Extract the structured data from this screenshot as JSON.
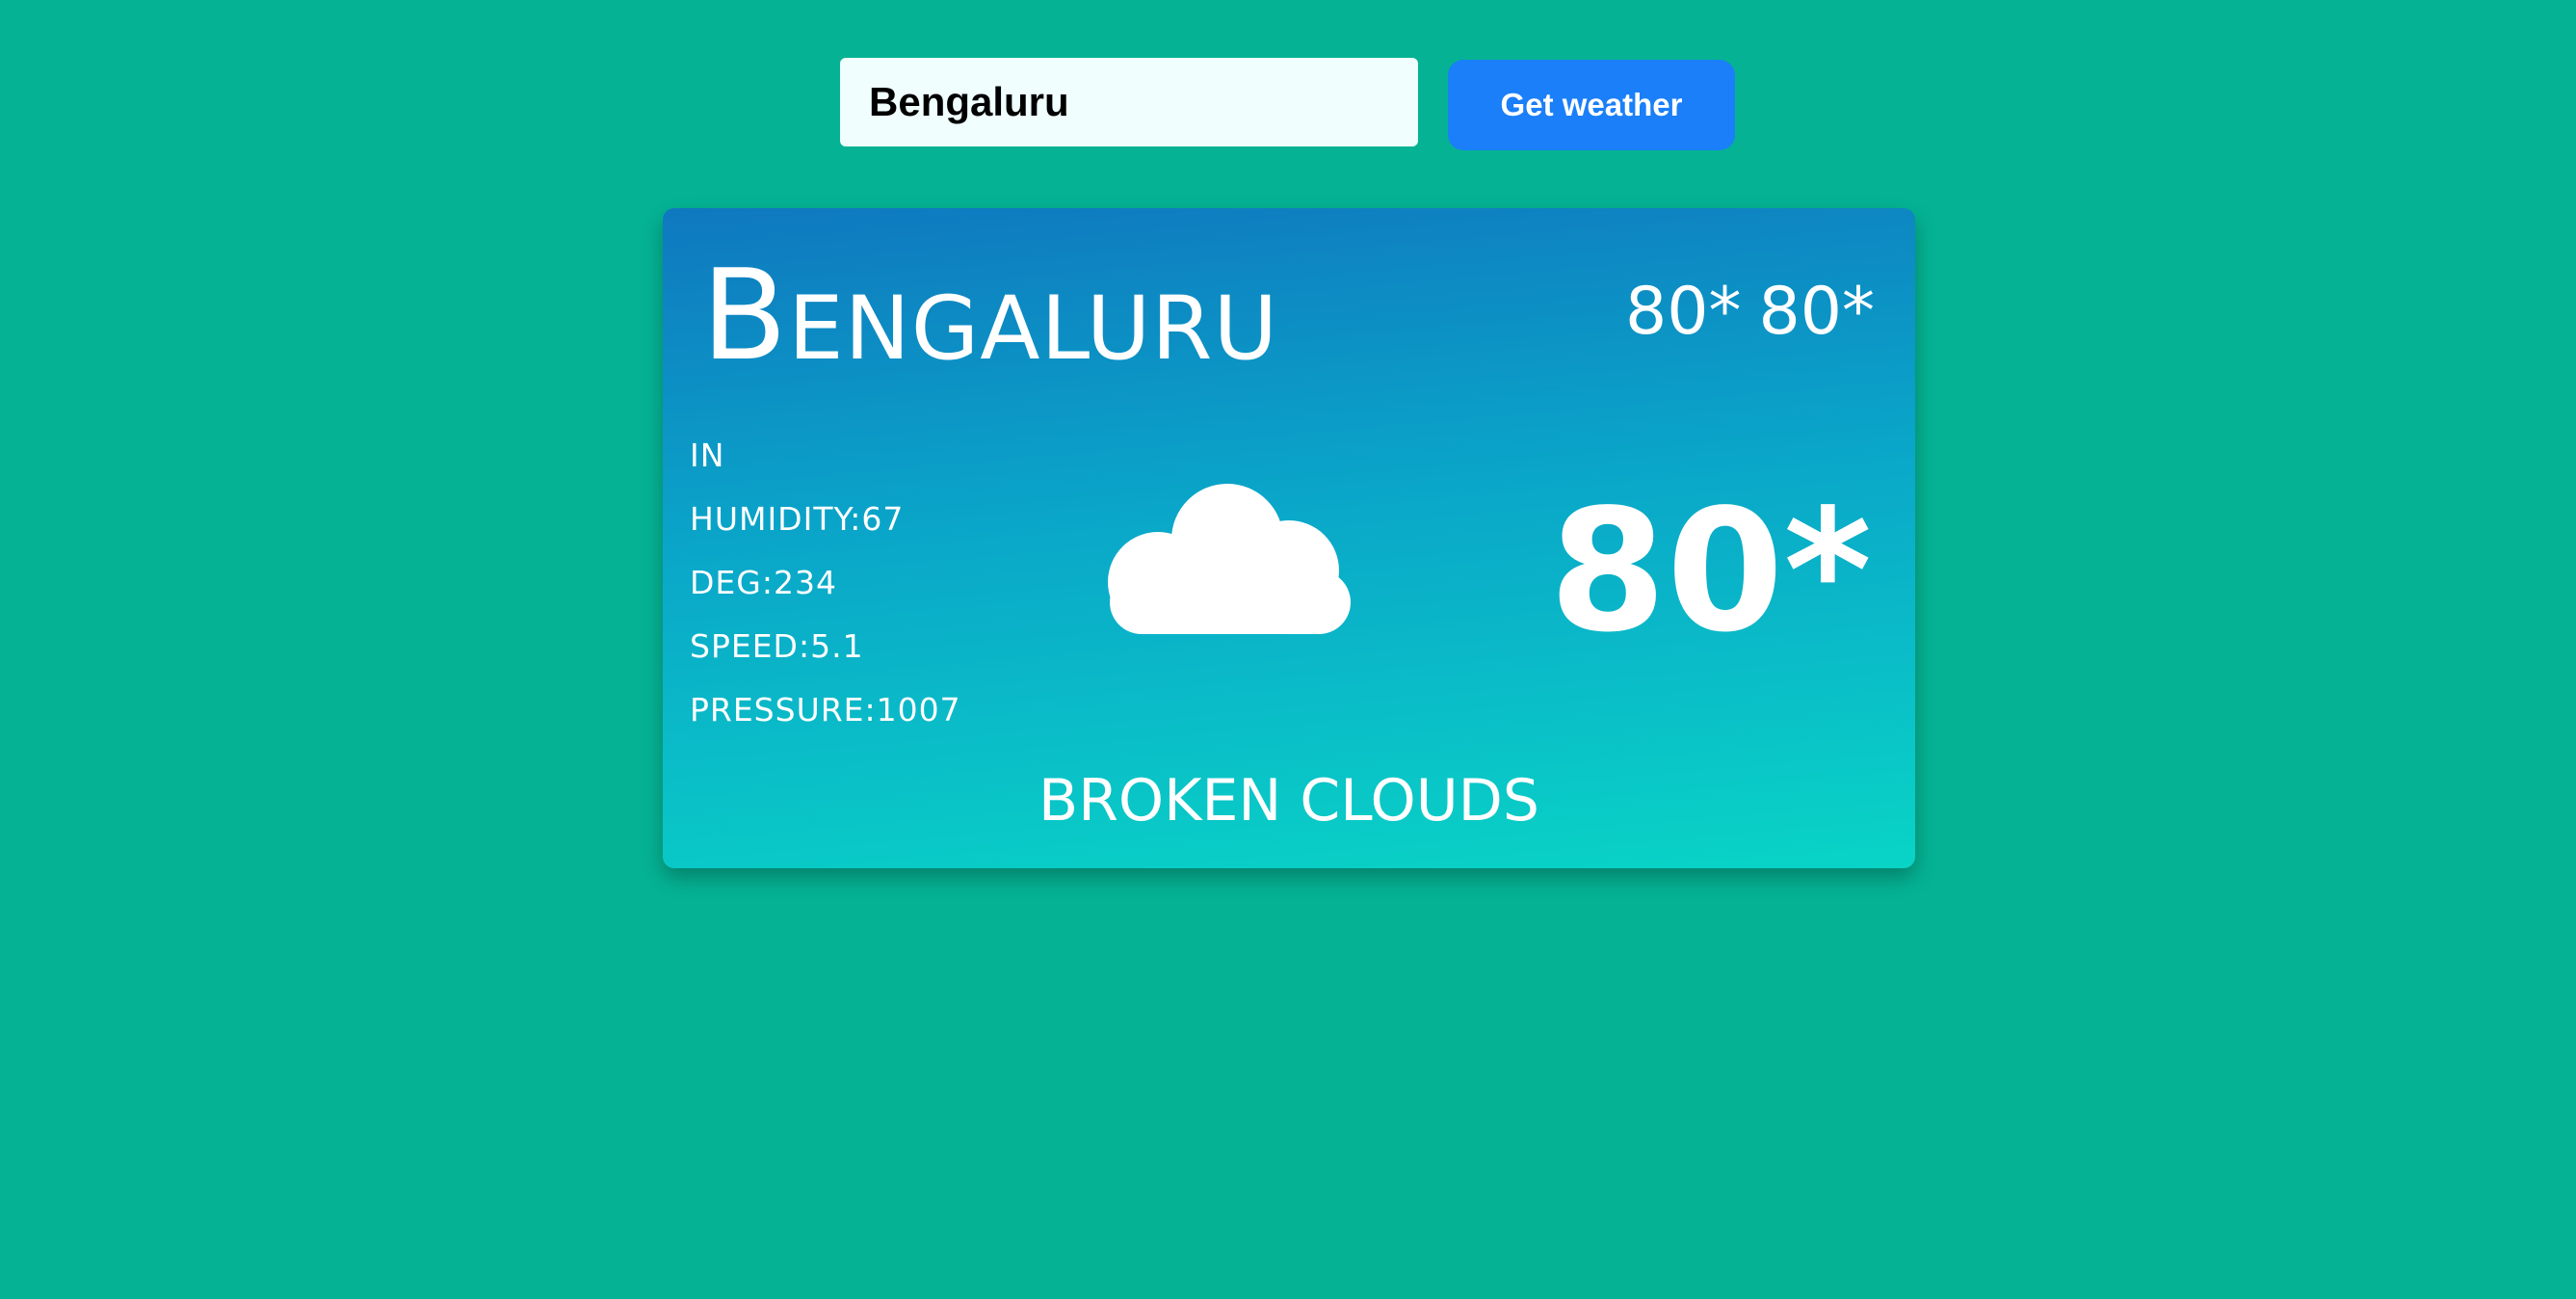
{
  "search": {
    "value": "Bengaluru",
    "button_label": "Get weather"
  },
  "card": {
    "city": "Bengaluru",
    "temp_min": "80*",
    "temp_max": "80*",
    "country": "IN",
    "humidity": "HUMIDITY:67",
    "deg": "DEG:234",
    "speed": "SPEED:5.1",
    "pressure": "PRESSURE:1007",
    "icon": "cloud-icon",
    "current_temp": "80*",
    "description": "BROKEN CLOUDS"
  },
  "colors": {
    "background": "#05b394",
    "button": "#1a7ff8",
    "input_background": "#f0fffe",
    "card_gradient_top": "#0f78bf",
    "card_gradient_bottom": "#09d4c6"
  }
}
